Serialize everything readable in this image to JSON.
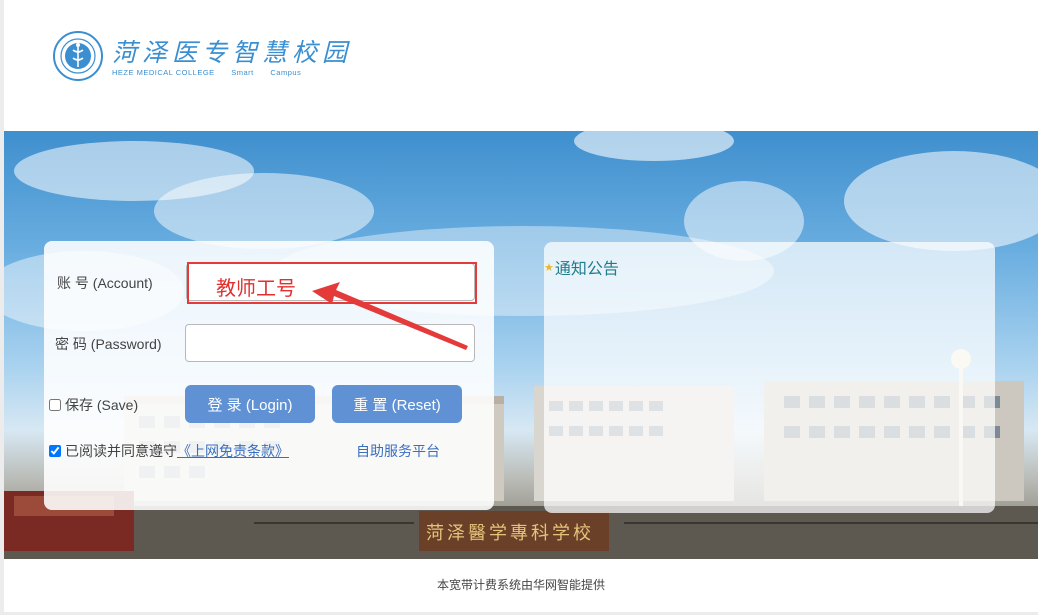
{
  "header": {
    "logo": {
      "cn_text": "菏泽医专智慧校园",
      "en_parts": [
        "HEZE MEDICAL COLLEGE",
        "Smart",
        "Campus"
      ]
    }
  },
  "banner": {
    "gate_sign": "菏泽醫学專科学校"
  },
  "login": {
    "account_label": "账   号 (Account)",
    "account_value": "",
    "password_label": "密   码 (Password)",
    "password_value": "",
    "annotation_text": "教师工号",
    "save_label": "保存 (Save)",
    "save_checked": false,
    "login_button": "登 录 (Login)",
    "reset_button": "重 置 (Reset)",
    "agree_prefix": "已阅读并同意遵守",
    "agree_link": "《上网免责条款》",
    "agree_checked": true,
    "self_service_link": "自助服务平台"
  },
  "notice": {
    "title": "通知公告"
  },
  "footer": {
    "text": "本宽带计费系统由华网智能提供"
  },
  "colors": {
    "button_bg": "#5f91d4",
    "annotation_red": "#e53a3a",
    "notice_title": "#1f7c8c",
    "link_blue": "#3a6fbf",
    "logo_blue": "#3b8fd0"
  }
}
